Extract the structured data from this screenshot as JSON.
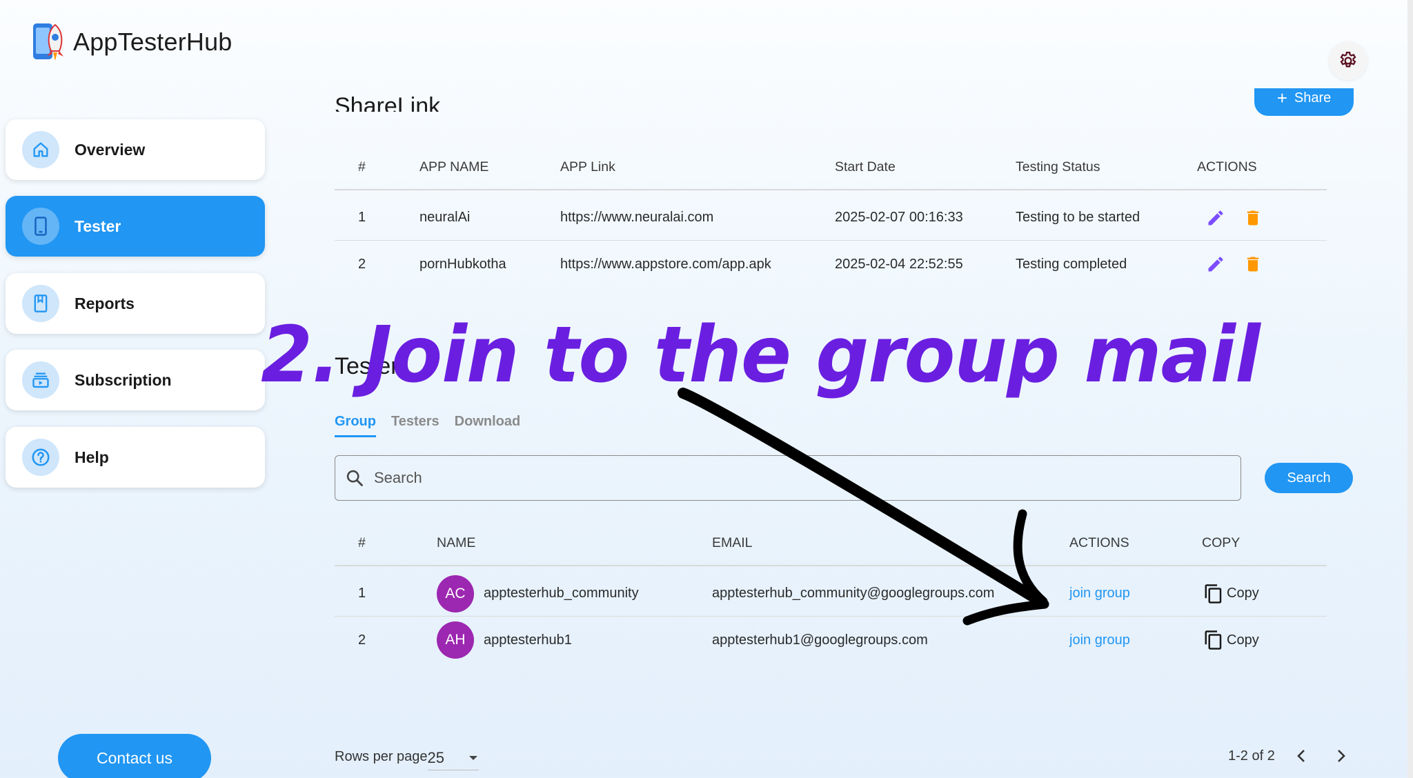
{
  "app": {
    "name": "AppTesterHub"
  },
  "sidebar": {
    "items": [
      {
        "label": "Overview",
        "icon": "home-icon"
      },
      {
        "label": "Tester",
        "icon": "phone-icon",
        "active": true
      },
      {
        "label": "Reports",
        "icon": "report-icon"
      },
      {
        "label": "Subscription",
        "icon": "subscription-icon"
      },
      {
        "label": "Help",
        "icon": "help-icon"
      }
    ],
    "contact_label": "Contact us"
  },
  "sharelink": {
    "title": "ShareLink",
    "share_label": "Share",
    "columns": [
      "#",
      "APP NAME",
      "APP Link",
      "Start Date",
      "Testing Status",
      "ACTIONS"
    ],
    "rows": [
      {
        "num": "1",
        "app_name": "neuralAi",
        "link": "https://www.neuralai.com",
        "start_date": "2025-02-07 00:16:33",
        "status": "Testing to be started"
      },
      {
        "num": "2",
        "app_name": "pornHubkotha",
        "link": "https://www.appstore.com/app.apk",
        "start_date": "2025-02-04 22:52:55",
        "status": "Testing completed"
      }
    ]
  },
  "tester": {
    "title": "Tester",
    "tabs": [
      "Group",
      "Testers",
      "Download"
    ],
    "active_tab": "Group",
    "search_placeholder": "Search",
    "search_button": "Search",
    "columns": [
      "#",
      "NAME",
      "EMAIL",
      "ACTIONS",
      "COPY"
    ],
    "rows": [
      {
        "num": "1",
        "initials": "AC",
        "name": "apptesterhub_community",
        "email": "apptesterhub_community@googlegroups.com",
        "action": "join group",
        "copy": "Copy"
      },
      {
        "num": "2",
        "initials": "AH",
        "name": "apptesterhub1",
        "email": "apptesterhub1@googlegroups.com",
        "action": "join group",
        "copy": "Copy"
      }
    ],
    "pagination": {
      "rows_per_page_label": "Rows per page",
      "rows_per_page": "25",
      "range": "1-2 of 2"
    }
  },
  "overlay": {
    "text": "2. Join to the group mail"
  },
  "colors": {
    "accent": "#2196f3",
    "edit": "#7c4dff",
    "delete": "#ff9800",
    "avatar": "#9c27b0",
    "overlay": "#6a1fe0"
  }
}
